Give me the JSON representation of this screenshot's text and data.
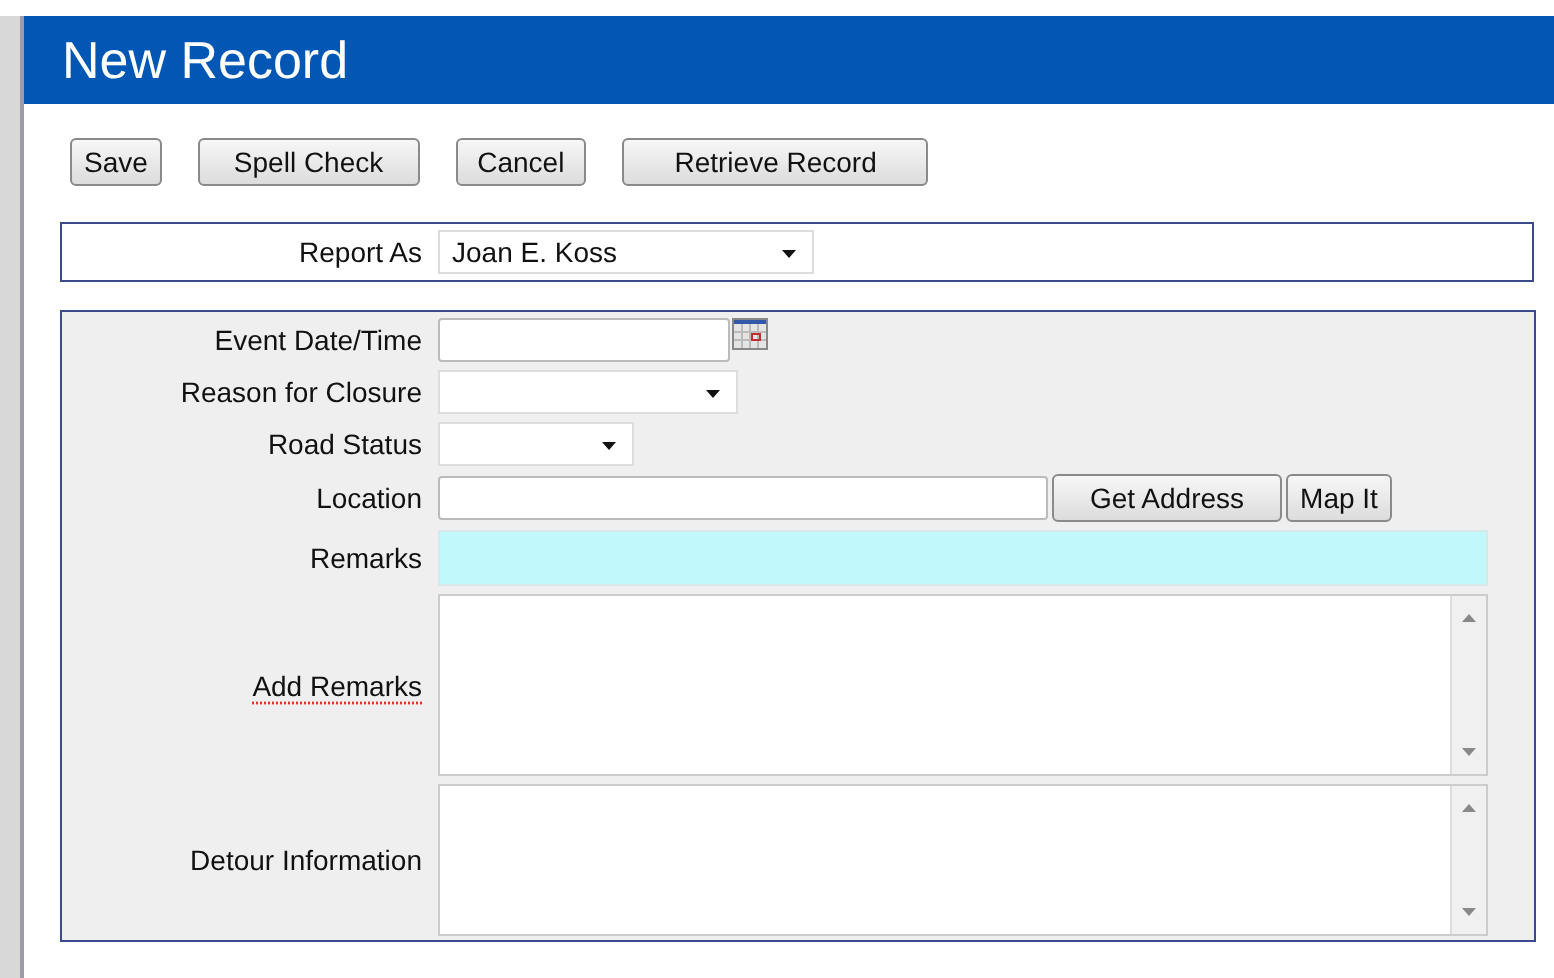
{
  "window": {
    "title": "New Record"
  },
  "toolbar": [
    {
      "label": "Save"
    },
    {
      "label": "Spell Check"
    },
    {
      "label": "Cancel"
    },
    {
      "label": "Retrieve Record"
    }
  ],
  "report_as": {
    "label": "Report As",
    "value": "Joan E. Koss"
  },
  "fields": [
    {
      "kind": "date",
      "label": "Event Date/Time",
      "misspelled": false
    },
    {
      "kind": "select",
      "label": "Reason for Closure",
      "misspelled": false
    },
    {
      "kind": "select",
      "label": "Road Status",
      "misspelled": false
    },
    {
      "kind": "location",
      "label": "Location",
      "misspelled": false,
      "buttons": [
        "Get Address",
        "Map It"
      ]
    },
    {
      "kind": "readonly",
      "label": "Remarks",
      "misspelled": false
    },
    {
      "kind": "textarea",
      "label": "Add Remarks",
      "misspelled": true
    },
    {
      "kind": "textarea",
      "label": "Detour Information",
      "misspelled": false
    }
  ]
}
